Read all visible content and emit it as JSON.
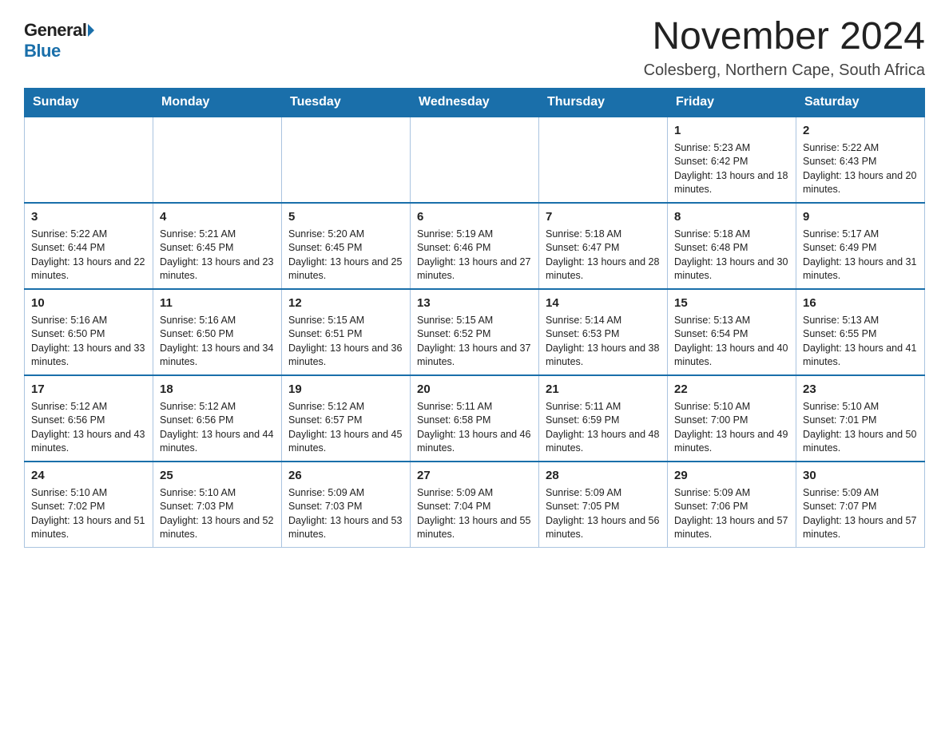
{
  "header": {
    "logo_general": "General",
    "logo_blue": "Blue",
    "month_title": "November 2024",
    "location": "Colesberg, Northern Cape, South Africa"
  },
  "weekdays": [
    "Sunday",
    "Monday",
    "Tuesday",
    "Wednesday",
    "Thursday",
    "Friday",
    "Saturday"
  ],
  "weeks": [
    [
      {
        "day": "",
        "sunrise": "",
        "sunset": "",
        "daylight": ""
      },
      {
        "day": "",
        "sunrise": "",
        "sunset": "",
        "daylight": ""
      },
      {
        "day": "",
        "sunrise": "",
        "sunset": "",
        "daylight": ""
      },
      {
        "day": "",
        "sunrise": "",
        "sunset": "",
        "daylight": ""
      },
      {
        "day": "",
        "sunrise": "",
        "sunset": "",
        "daylight": ""
      },
      {
        "day": "1",
        "sunrise": "Sunrise: 5:23 AM",
        "sunset": "Sunset: 6:42 PM",
        "daylight": "Daylight: 13 hours and 18 minutes."
      },
      {
        "day": "2",
        "sunrise": "Sunrise: 5:22 AM",
        "sunset": "Sunset: 6:43 PM",
        "daylight": "Daylight: 13 hours and 20 minutes."
      }
    ],
    [
      {
        "day": "3",
        "sunrise": "Sunrise: 5:22 AM",
        "sunset": "Sunset: 6:44 PM",
        "daylight": "Daylight: 13 hours and 22 minutes."
      },
      {
        "day": "4",
        "sunrise": "Sunrise: 5:21 AM",
        "sunset": "Sunset: 6:45 PM",
        "daylight": "Daylight: 13 hours and 23 minutes."
      },
      {
        "day": "5",
        "sunrise": "Sunrise: 5:20 AM",
        "sunset": "Sunset: 6:45 PM",
        "daylight": "Daylight: 13 hours and 25 minutes."
      },
      {
        "day": "6",
        "sunrise": "Sunrise: 5:19 AM",
        "sunset": "Sunset: 6:46 PM",
        "daylight": "Daylight: 13 hours and 27 minutes."
      },
      {
        "day": "7",
        "sunrise": "Sunrise: 5:18 AM",
        "sunset": "Sunset: 6:47 PM",
        "daylight": "Daylight: 13 hours and 28 minutes."
      },
      {
        "day": "8",
        "sunrise": "Sunrise: 5:18 AM",
        "sunset": "Sunset: 6:48 PM",
        "daylight": "Daylight: 13 hours and 30 minutes."
      },
      {
        "day": "9",
        "sunrise": "Sunrise: 5:17 AM",
        "sunset": "Sunset: 6:49 PM",
        "daylight": "Daylight: 13 hours and 31 minutes."
      }
    ],
    [
      {
        "day": "10",
        "sunrise": "Sunrise: 5:16 AM",
        "sunset": "Sunset: 6:50 PM",
        "daylight": "Daylight: 13 hours and 33 minutes."
      },
      {
        "day": "11",
        "sunrise": "Sunrise: 5:16 AM",
        "sunset": "Sunset: 6:50 PM",
        "daylight": "Daylight: 13 hours and 34 minutes."
      },
      {
        "day": "12",
        "sunrise": "Sunrise: 5:15 AM",
        "sunset": "Sunset: 6:51 PM",
        "daylight": "Daylight: 13 hours and 36 minutes."
      },
      {
        "day": "13",
        "sunrise": "Sunrise: 5:15 AM",
        "sunset": "Sunset: 6:52 PM",
        "daylight": "Daylight: 13 hours and 37 minutes."
      },
      {
        "day": "14",
        "sunrise": "Sunrise: 5:14 AM",
        "sunset": "Sunset: 6:53 PM",
        "daylight": "Daylight: 13 hours and 38 minutes."
      },
      {
        "day": "15",
        "sunrise": "Sunrise: 5:13 AM",
        "sunset": "Sunset: 6:54 PM",
        "daylight": "Daylight: 13 hours and 40 minutes."
      },
      {
        "day": "16",
        "sunrise": "Sunrise: 5:13 AM",
        "sunset": "Sunset: 6:55 PM",
        "daylight": "Daylight: 13 hours and 41 minutes."
      }
    ],
    [
      {
        "day": "17",
        "sunrise": "Sunrise: 5:12 AM",
        "sunset": "Sunset: 6:56 PM",
        "daylight": "Daylight: 13 hours and 43 minutes."
      },
      {
        "day": "18",
        "sunrise": "Sunrise: 5:12 AM",
        "sunset": "Sunset: 6:56 PM",
        "daylight": "Daylight: 13 hours and 44 minutes."
      },
      {
        "day": "19",
        "sunrise": "Sunrise: 5:12 AM",
        "sunset": "Sunset: 6:57 PM",
        "daylight": "Daylight: 13 hours and 45 minutes."
      },
      {
        "day": "20",
        "sunrise": "Sunrise: 5:11 AM",
        "sunset": "Sunset: 6:58 PM",
        "daylight": "Daylight: 13 hours and 46 minutes."
      },
      {
        "day": "21",
        "sunrise": "Sunrise: 5:11 AM",
        "sunset": "Sunset: 6:59 PM",
        "daylight": "Daylight: 13 hours and 48 minutes."
      },
      {
        "day": "22",
        "sunrise": "Sunrise: 5:10 AM",
        "sunset": "Sunset: 7:00 PM",
        "daylight": "Daylight: 13 hours and 49 minutes."
      },
      {
        "day": "23",
        "sunrise": "Sunrise: 5:10 AM",
        "sunset": "Sunset: 7:01 PM",
        "daylight": "Daylight: 13 hours and 50 minutes."
      }
    ],
    [
      {
        "day": "24",
        "sunrise": "Sunrise: 5:10 AM",
        "sunset": "Sunset: 7:02 PM",
        "daylight": "Daylight: 13 hours and 51 minutes."
      },
      {
        "day": "25",
        "sunrise": "Sunrise: 5:10 AM",
        "sunset": "Sunset: 7:03 PM",
        "daylight": "Daylight: 13 hours and 52 minutes."
      },
      {
        "day": "26",
        "sunrise": "Sunrise: 5:09 AM",
        "sunset": "Sunset: 7:03 PM",
        "daylight": "Daylight: 13 hours and 53 minutes."
      },
      {
        "day": "27",
        "sunrise": "Sunrise: 5:09 AM",
        "sunset": "Sunset: 7:04 PM",
        "daylight": "Daylight: 13 hours and 55 minutes."
      },
      {
        "day": "28",
        "sunrise": "Sunrise: 5:09 AM",
        "sunset": "Sunset: 7:05 PM",
        "daylight": "Daylight: 13 hours and 56 minutes."
      },
      {
        "day": "29",
        "sunrise": "Sunrise: 5:09 AM",
        "sunset": "Sunset: 7:06 PM",
        "daylight": "Daylight: 13 hours and 57 minutes."
      },
      {
        "day": "30",
        "sunrise": "Sunrise: 5:09 AM",
        "sunset": "Sunset: 7:07 PM",
        "daylight": "Daylight: 13 hours and 57 minutes."
      }
    ]
  ]
}
